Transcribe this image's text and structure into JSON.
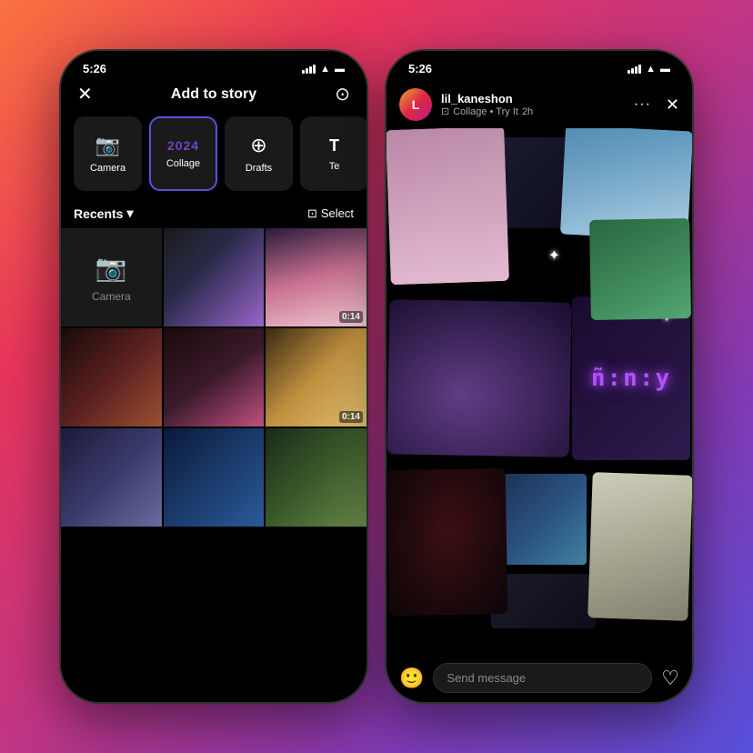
{
  "background": {
    "gradient": "135deg, #f97340 0%, #e8355a 25%, #c13584 50%, #833ab4 75%, #5851db 100%"
  },
  "phone1": {
    "status_bar": {
      "time": "5:26",
      "signal": "signal",
      "wifi": "wifi",
      "battery": "battery"
    },
    "header": {
      "close_icon": "✕",
      "title": "Add to story",
      "settings_icon": "⊙"
    },
    "tabs": [
      {
        "id": "camera",
        "icon": "📷",
        "label": "Camera",
        "active": false
      },
      {
        "id": "collage",
        "icon": "2024",
        "label": "Collage",
        "active": true
      },
      {
        "id": "drafts",
        "icon": "⊕",
        "label": "Drafts",
        "active": false
      },
      {
        "id": "text",
        "icon": "T",
        "label": "Te...",
        "active": false
      }
    ],
    "recents": {
      "label": "Recents",
      "dropdown_icon": "▾",
      "select_icon": "⊡",
      "select_label": "Select"
    },
    "grid": {
      "camera_label": "Camera",
      "video_durations": [
        "0:14",
        "0:14"
      ]
    }
  },
  "phone2": {
    "status_bar": {
      "time": "5:26",
      "signal": "signal",
      "wifi": "wifi",
      "battery": "battery"
    },
    "story_header": {
      "username": "lil_kaneshon",
      "time": "2h",
      "tag": "Collage • Try It",
      "more_icon": "···",
      "close_icon": "✕"
    },
    "neon_text": "ñ:n:y",
    "message_bar": {
      "emoji_icon": "🙂",
      "placeholder": "Send message",
      "heart_icon": "♡"
    }
  }
}
